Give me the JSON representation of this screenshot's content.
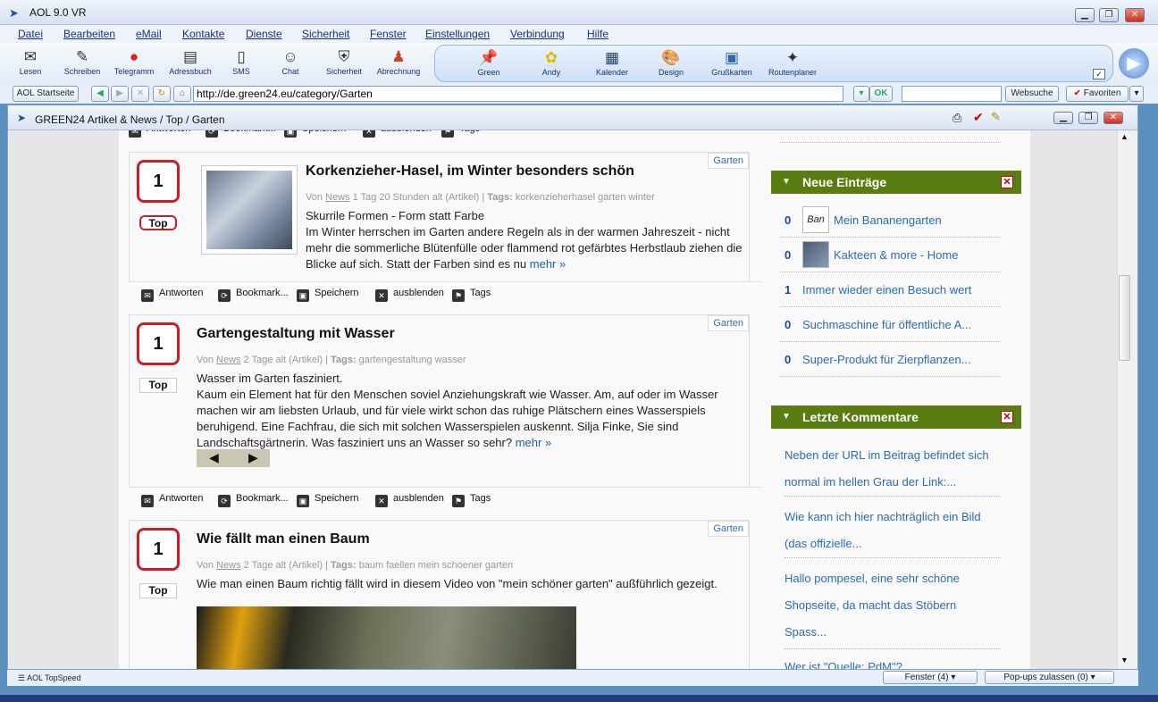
{
  "window": {
    "title": "AOL 9.0 VR"
  },
  "menu": [
    "Datei",
    "Bearbeiten",
    "eMail",
    "Kontakte",
    "Dienste",
    "Sicherheit",
    "Fenster",
    "Einstellungen",
    "Verbindung",
    "Hilfe"
  ],
  "toolbar": {
    "left": [
      "Lesen",
      "Schreiben",
      "Telegramm",
      "Adressbuch",
      "SMS",
      "Chat",
      "Sicherheit",
      "Abrechnung"
    ],
    "favs": [
      "Green",
      "Andy",
      "Kalender",
      "Design",
      "Grußkarten",
      "Routenplaner"
    ]
  },
  "nav": {
    "home": "AOL Startseite",
    "url": "http://de.green24.eu/category/Garten",
    "ok": "OK",
    "websuche": "Websuche",
    "favoriten": "Favoriten"
  },
  "doc": {
    "title": "GREEN24 Artikel & News / Top / Garten"
  },
  "actions": {
    "reply": "Antworten",
    "bookmark": "Bookmark...",
    "save": "Speichern",
    "hide": "ausblenden",
    "tags": "Tags"
  },
  "articles": [
    {
      "votes": "1",
      "top": "Top",
      "category": "Garten",
      "title": "Korkenzieher-Hasel, im Winter besonders schön",
      "meta_von": "Von",
      "meta_author": "News",
      "meta_rest": "1 Tag 20 Stunden alt (Artikel) |",
      "meta_tags_label": "Tags:",
      "meta_tags": "korkenzieherhasel garten winter",
      "lead": "Skurrile Formen - Form statt Farbe",
      "body": "Im Winter herrschen im Garten andere Regeln als in der warmen Jahreszeit - nicht mehr die sommerliche Blütenfülle oder flammend rot gefärbtes Herbstlaub ziehen die Blicke auf sich. Statt der Farben sind es nu",
      "more": "mehr »"
    },
    {
      "votes": "1",
      "top": "Top",
      "category": "Garten",
      "title": "Gartengestaltung mit Wasser",
      "meta_von": "Von",
      "meta_author": "News",
      "meta_rest": "2 Tage alt (Artikel) |",
      "meta_tags_label": "Tags:",
      "meta_tags": "gartengestaltung wasser",
      "lead": "Wasser im Garten fasziniert.",
      "body": "Kaum ein Element hat für den Menschen soviel Anziehungskraft wie Wasser. Am, auf oder im Wasser machen wir am liebsten Urlaub, und für viele wirkt schon das ruhige Plätschern eines Wasserspiels beruhigend. Eine Fachfrau, die sich mit solchen Wasserspielen auskennt. Silja Finke, Sie sind Landschaftsgärtnerin. Was fasziniert uns an Wasser so sehr?",
      "more": "mehr »"
    },
    {
      "votes": "1",
      "top": "Top",
      "category": "Garten",
      "title": "Wie fällt man einen Baum",
      "meta_von": "Von",
      "meta_author": "News",
      "meta_rest": "2 Tage alt (Artikel) |",
      "meta_tags_label": "Tags:",
      "meta_tags": "baum faellen mein schoener garten",
      "lead": "Wie man einen Baum richtig fällt wird in diesem Video von \"mein schöner garten\" außführlich gezeigt."
    }
  ],
  "sidebar": {
    "neue_title": "Neue Einträge",
    "entries": [
      {
        "n": "0",
        "label": "Mein Bananengarten",
        "icon": "Ban"
      },
      {
        "n": "0",
        "label": "Kakteen & more - Home"
      },
      {
        "n": "1",
        "label": "Immer wieder einen Besuch wert"
      },
      {
        "n": "0",
        "label": "Suchmaschine für öffentliche A..."
      },
      {
        "n": "0",
        "label": "Super-Produkt für Zierpflanzen..."
      }
    ],
    "komm_title": "Letzte Kommentare",
    "comments": [
      "Neben der URL im Beitrag befindet sich normal im hellen Grau der Link:...",
      "Wie kann ich hier nachträglich ein Bild (das offizielle...",
      "Hallo pompesel, eine sehr schöne Shopseite, da macht das Stöbern Spass...",
      "Wer ist \"Quelle: PdM\"?"
    ]
  },
  "status": {
    "speed": "AOL TopSpeed",
    "fenster": "Fenster (4)",
    "popups": "Pop-ups zulassen (0)"
  }
}
